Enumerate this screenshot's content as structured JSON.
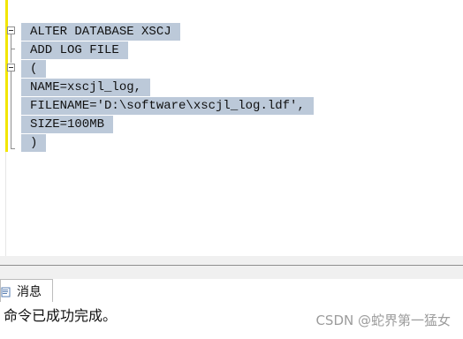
{
  "editor": {
    "lines": [
      "ALTER DATABASE XSCJ",
      "ADD LOG FILE",
      "(",
      "NAME=xscjl_log,",
      "FILENAME='D:\\software\\xscjl_log.ldf',",
      "SIZE=100MB",
      ")"
    ]
  },
  "results": {
    "tab_label": "消息",
    "tab_icon": "messages-icon",
    "message": "命令已成功完成。"
  },
  "watermark": "CSDN @蛇界第一猛女"
}
